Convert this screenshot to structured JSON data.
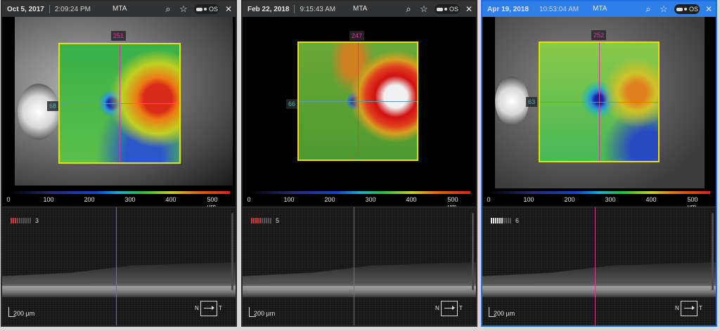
{
  "colors": {
    "active_border": "#2f7fe8",
    "map_frame": "#e8e000",
    "vertical_line": "#c8409c",
    "horizontal_line": "#5a9ab8"
  },
  "panels": [
    {
      "date": "Oct 5, 2017",
      "time": "2:09:24 PM",
      "mode": "MTA",
      "eye": "OS",
      "v_label": "251",
      "h_label": "68",
      "quality": 3,
      "quality_label": "3",
      "scale_ticks": [
        "0",
        "100",
        "200",
        "300",
        "400",
        "500 µm"
      ],
      "scale_bar": "200 µm",
      "orient_n": "N",
      "orient_t": "T",
      "icons": {
        "search": "search-icon",
        "star": "star-icon",
        "close": "close-icon"
      }
    },
    {
      "date": "Feb 22, 2018",
      "time": "9:15:43 AM",
      "mode": "MTA",
      "eye": "OS",
      "v_label": "247",
      "h_label": "66",
      "quality": 5,
      "quality_label": "5",
      "scale_ticks": [
        "0",
        "100",
        "200",
        "300",
        "400",
        "500 µm"
      ],
      "scale_bar": "200 µm",
      "orient_n": "N",
      "orient_t": "T",
      "icons": {
        "search": "search-icon",
        "star": "star-icon",
        "close": "close-icon"
      }
    },
    {
      "date": "Apr 19, 2018",
      "time": "10:53:04 AM",
      "mode": "MTA",
      "eye": "OS",
      "v_label": "252",
      "h_label": "63",
      "quality": 6,
      "quality_label": "6",
      "scale_ticks": [
        "0",
        "100",
        "200",
        "300",
        "400",
        "500 µm"
      ],
      "scale_bar": "200 µm",
      "orient_n": "N",
      "orient_t": "T",
      "icons": {
        "search": "search-icon",
        "star": "star-icon",
        "close": "close-icon"
      }
    }
  ]
}
